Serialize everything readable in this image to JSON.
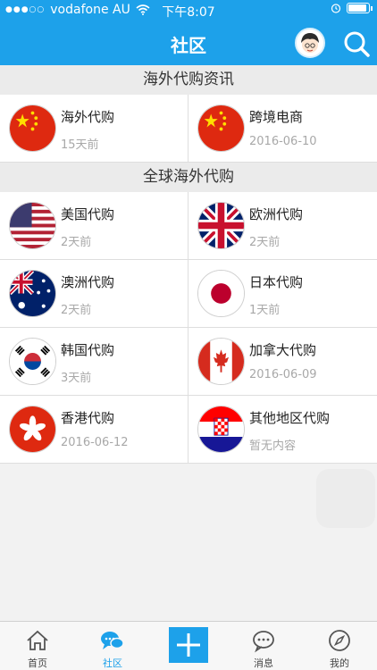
{
  "status_bar": {
    "signal": "●●●○○",
    "carrier": "vodafone AU",
    "time": "下午8:07"
  },
  "nav": {
    "title": "社区"
  },
  "sections": [
    {
      "title": "海外代购资讯",
      "items": [
        {
          "name": "海外代购",
          "sub": "15天前",
          "flag": "china-flag-icon"
        },
        {
          "name": "跨境电商",
          "sub": "2016-06-10",
          "flag": "china-flag-icon"
        }
      ]
    },
    {
      "title": "全球海外代购",
      "items": [
        {
          "name": "美国代购",
          "sub": "2天前",
          "flag": "usa-flag-icon"
        },
        {
          "name": "欧洲代购",
          "sub": "2天前",
          "flag": "uk-flag-icon"
        },
        {
          "name": "澳洲代购",
          "sub": "2天前",
          "flag": "australia-flag-icon"
        },
        {
          "name": "日本代购",
          "sub": "1天前",
          "flag": "japan-flag-icon"
        },
        {
          "name": "韩国代购",
          "sub": "3天前",
          "flag": "korea-flag-icon"
        },
        {
          "name": "加拿大代购",
          "sub": "2016-06-09",
          "flag": "canada-flag-icon"
        },
        {
          "name": "香港代购",
          "sub": "2016-06-12",
          "flag": "hongkong-flag-icon"
        },
        {
          "name": "其他地区代购",
          "sub": "暂无内容",
          "flag": "croatia-flag-icon"
        }
      ]
    }
  ],
  "tabs": [
    {
      "label": "首页",
      "icon": "home-icon"
    },
    {
      "label": "社区",
      "icon": "community-chat-icon",
      "active": true
    },
    {
      "label": "",
      "icon": "add-icon"
    },
    {
      "label": "消息",
      "icon": "message-icon"
    },
    {
      "label": "我的",
      "icon": "compass-icon"
    }
  ],
  "colors": {
    "primary": "#1da1ea",
    "background": "#f2f2f2",
    "subtext": "#a8a8a8"
  }
}
